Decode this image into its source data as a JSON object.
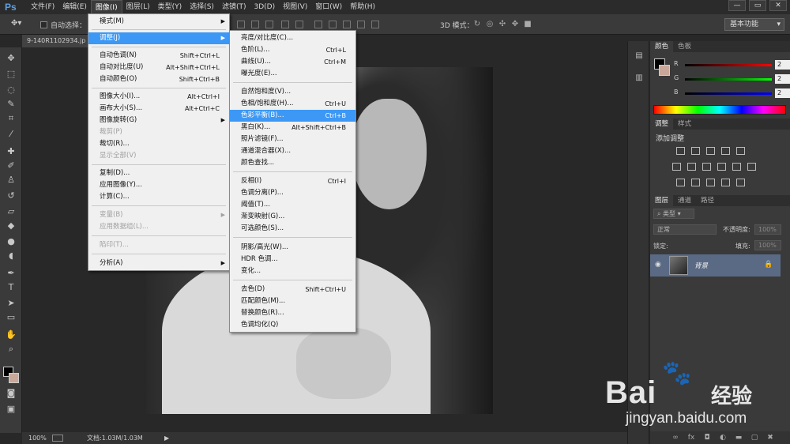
{
  "app": {
    "logo": "Ps"
  },
  "menubar": {
    "items": [
      "文件(F)",
      "编辑(E)",
      "图像(I)",
      "图层(L)",
      "类型(Y)",
      "选择(S)",
      "滤镜(T)",
      "3D(D)",
      "视图(V)",
      "窗口(W)",
      "帮助(H)"
    ],
    "active": "图像(I)"
  },
  "window_controls": {
    "minimize": "—",
    "restore": "▭",
    "close": "✕"
  },
  "options": {
    "auto_select": "自动选择：",
    "mode_3d": "3D 模式：",
    "workspace": "基本功能"
  },
  "document": {
    "tab": "9-140R1102934.jp"
  },
  "status": {
    "zoom": "100%",
    "doc_info": "文档:1.03M/1.03M",
    "arrow": "▶"
  },
  "image_menu": {
    "items": [
      {
        "label": "模式(M)",
        "shortcut": "",
        "submenu": true
      },
      {
        "label": "调整(J)",
        "shortcut": "",
        "submenu": true,
        "highlight": true
      },
      {
        "label": "自动色调(N)",
        "shortcut": "Shift+Ctrl+L"
      },
      {
        "label": "自动对比度(U)",
        "shortcut": "Alt+Shift+Ctrl+L"
      },
      {
        "label": "自动颜色(O)",
        "shortcut": "Shift+Ctrl+B"
      },
      {
        "label": "图像大小(I)...",
        "shortcut": "Alt+Ctrl+I"
      },
      {
        "label": "画布大小(S)...",
        "shortcut": "Alt+Ctrl+C"
      },
      {
        "label": "图像旋转(G)",
        "shortcut": "",
        "submenu": true
      },
      {
        "label": "裁剪(P)",
        "shortcut": "",
        "disabled": true
      },
      {
        "label": "裁切(R)...",
        "shortcut": ""
      },
      {
        "label": "显示全部(V)",
        "shortcut": "",
        "disabled": true
      },
      {
        "label": "复制(D)...",
        "shortcut": ""
      },
      {
        "label": "应用图像(Y)...",
        "shortcut": ""
      },
      {
        "label": "计算(C)...",
        "shortcut": ""
      },
      {
        "label": "变量(B)",
        "shortcut": "",
        "submenu": true,
        "disabled": true
      },
      {
        "label": "应用数据组(L)...",
        "shortcut": "",
        "disabled": true
      },
      {
        "label": "陷印(T)...",
        "shortcut": "",
        "disabled": true
      },
      {
        "label": "分析(A)",
        "shortcut": "",
        "submenu": true
      }
    ]
  },
  "adjust_menu": {
    "items": [
      {
        "label": "亮度/对比度(C)...",
        "shortcut": ""
      },
      {
        "label": "色阶(L)...",
        "shortcut": "Ctrl+L"
      },
      {
        "label": "曲线(U)...",
        "shortcut": "Ctrl+M"
      },
      {
        "label": "曝光度(E)...",
        "shortcut": ""
      },
      {
        "label": "自然饱和度(V)...",
        "shortcut": ""
      },
      {
        "label": "色相/饱和度(H)...",
        "shortcut": "Ctrl+U"
      },
      {
        "label": "色彩平衡(B)...",
        "shortcut": "Ctrl+B",
        "highlight": true
      },
      {
        "label": "黑白(K)...",
        "shortcut": "Alt+Shift+Ctrl+B"
      },
      {
        "label": "照片滤镜(F)...",
        "shortcut": ""
      },
      {
        "label": "通道混合器(X)...",
        "shortcut": ""
      },
      {
        "label": "颜色查找...",
        "shortcut": ""
      },
      {
        "label": "反相(I)",
        "shortcut": "Ctrl+I"
      },
      {
        "label": "色调分离(P)...",
        "shortcut": ""
      },
      {
        "label": "阈值(T)...",
        "shortcut": ""
      },
      {
        "label": "渐变映射(G)...",
        "shortcut": ""
      },
      {
        "label": "可选颜色(S)...",
        "shortcut": ""
      },
      {
        "label": "阴影/高光(W)...",
        "shortcut": ""
      },
      {
        "label": "HDR 色调...",
        "shortcut": ""
      },
      {
        "label": "变化...",
        "shortcut": ""
      },
      {
        "label": "去色(D)",
        "shortcut": "Shift+Ctrl+U"
      },
      {
        "label": "匹配颜色(M)...",
        "shortcut": ""
      },
      {
        "label": "替换颜色(R)...",
        "shortcut": ""
      },
      {
        "label": "色调均化(Q)",
        "shortcut": ""
      }
    ]
  },
  "color_panel": {
    "tabs": [
      "颜色",
      "色板"
    ],
    "channels": [
      {
        "label": "R",
        "value": "2"
      },
      {
        "label": "G",
        "value": "2"
      },
      {
        "label": "B",
        "value": "2"
      }
    ]
  },
  "adjust_panel": {
    "tabs": [
      "调整",
      "样式"
    ],
    "title": "添加调整"
  },
  "layers_panel": {
    "tabs": [
      "图层",
      "通道",
      "路径"
    ],
    "filter": "类型",
    "blend_mode": "正常",
    "opacity_label": "不透明度:",
    "opacity_value": "100%",
    "lock_label": "锁定:",
    "fill_label": "填充:",
    "fill_value": "100%",
    "layer_name": "背景"
  },
  "watermark": {
    "brand": "Bai",
    "brand_cn": "经验",
    "url": "jingyan.baidu.com"
  },
  "colors": {
    "highlight": "#3d98f5",
    "menu_bg": "#f0f0f0"
  }
}
